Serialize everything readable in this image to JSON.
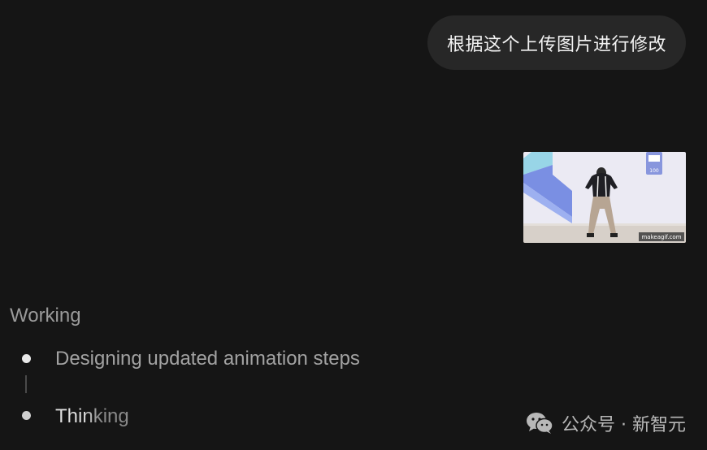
{
  "chat": {
    "user_message": "根据这个上传图片进行修改",
    "attachment": {
      "watermark_text": "makeagif.com",
      "badge_text": "100"
    }
  },
  "status": {
    "working_label": "Working",
    "steps": [
      {
        "label": "Designing updated animation steps",
        "state": "done"
      },
      {
        "label": "Thinking",
        "state": "active"
      }
    ]
  },
  "watermark": {
    "text": "公众号 · 新智元",
    "icon": "wechat-icon"
  },
  "colors": {
    "background": "#151515",
    "bubble": "#272727"
  }
}
